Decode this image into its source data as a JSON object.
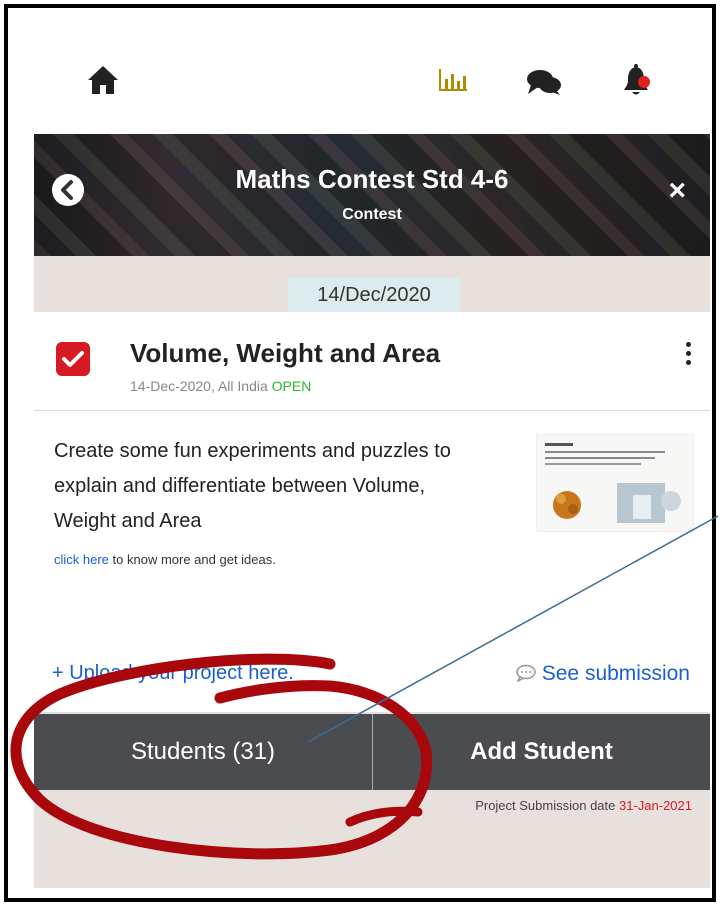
{
  "header": {
    "icons": [
      "home-icon",
      "bar-chart-icon",
      "chat-icon",
      "notification-bell-icon"
    ]
  },
  "banner": {
    "title": "Maths Contest Std 4-6",
    "subtitle": "Contest",
    "close_glyph": "×"
  },
  "date_chip": "14/Dec/2020",
  "project": {
    "title": "Volume, Weight and Area",
    "meta_prefix": "14-Dec-2020, All India",
    "status": "OPEN",
    "description": "Create some fun experiments and puzzles to explain and differentiate between Volume, Weight and Area",
    "link_text": "click here",
    "link_suffix": " to know more and get ideas.",
    "upload_label": "+ Upload your project here.",
    "see_submission_label": "See submission"
  },
  "actions": {
    "students_label": "Students (31)",
    "add_student_label": "Add Student"
  },
  "footer": {
    "submission_label": "Project Submission date",
    "submission_date": "31-Jan-2021"
  },
  "colors": {
    "accent_red": "#d61a23",
    "link_blue": "#1a5fd0",
    "open_green": "#2eb82e",
    "button_bar": "#4a4c4f",
    "annotation_red": "#a8070b"
  }
}
